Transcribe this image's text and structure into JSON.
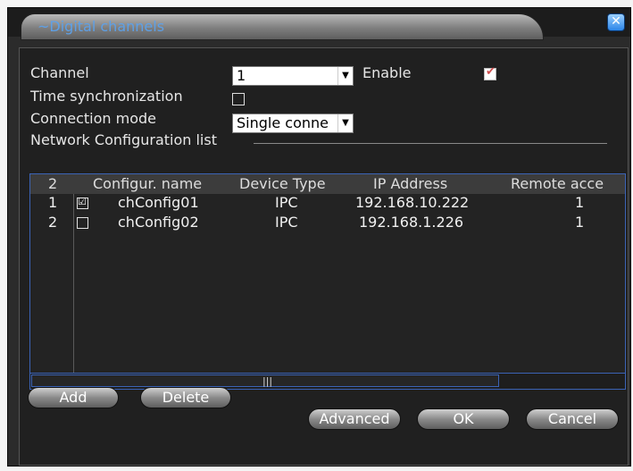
{
  "dialog": {
    "title": "Digital channels",
    "title_prefix": "~"
  },
  "form": {
    "channel_label": "Channel",
    "channel_value": "1",
    "enable_label": "Enable",
    "enable_checked": true,
    "time_sync_label": "Time synchronization",
    "time_sync_checked": false,
    "connection_mode_label": "Connection mode",
    "connection_mode_value": "Single conne"
  },
  "network": {
    "section_label": "Network Configuration list",
    "headers": [
      "2",
      "Configur. name",
      "Device Type",
      "IP Address",
      "Remote acce"
    ],
    "rows": [
      {
        "index": "1",
        "checked": true,
        "name": "chConfig01",
        "type": "IPC",
        "ip": "192.168.10.222",
        "remote": "1"
      },
      {
        "index": "2",
        "checked": false,
        "name": "chConfig02",
        "type": "IPC",
        "ip": "192.168.1.226",
        "remote": "1"
      }
    ],
    "scroll_grip": "|||"
  },
  "buttons": {
    "add": "Add",
    "delete": "Delete",
    "advanced": "Advanced",
    "ok": "OK",
    "cancel": "Cancel"
  },
  "icons": {
    "close": "close-icon",
    "dropdown": "chevron-down-icon",
    "check": "checkmark-icon"
  }
}
